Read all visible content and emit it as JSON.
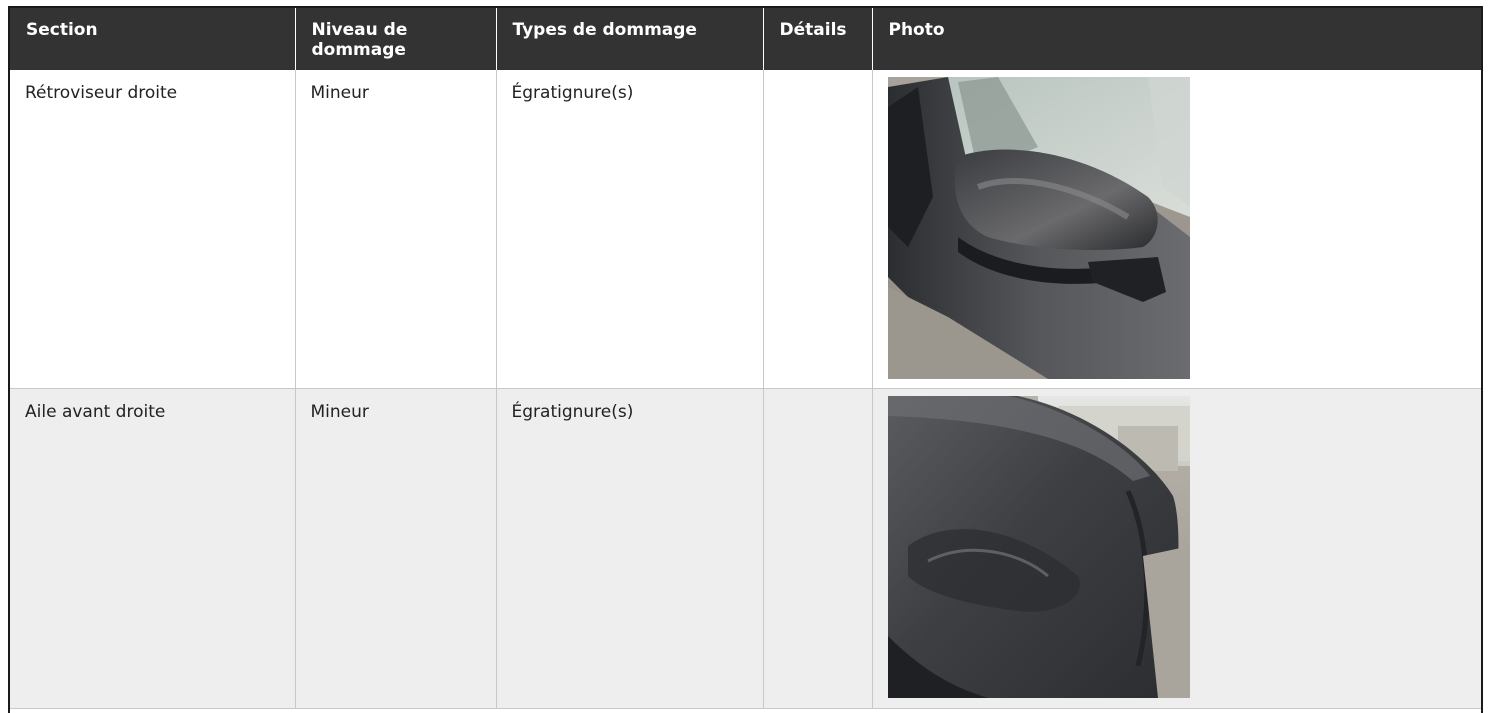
{
  "table": {
    "headers": [
      "Section",
      "Niveau de dommage",
      "Types de dommage",
      "Détails",
      "Photo"
    ],
    "rows": [
      {
        "section": "Rétroviseur droite",
        "niveau": "Mineur",
        "types": "Égratignure(s)",
        "details": "",
        "photo_icon": "car-mirror-photo"
      },
      {
        "section": "Aile avant droite",
        "niveau": "Mineur",
        "types": "Égratignure(s)",
        "details": "",
        "photo_icon": "car-fender-photo"
      }
    ]
  },
  "colors": {
    "header_bg": "#333333",
    "header_text": "#ffffff",
    "row_alt_bg": "#eeeeee",
    "border": "#c8c8c8",
    "car_paint": "#4a4c50"
  }
}
